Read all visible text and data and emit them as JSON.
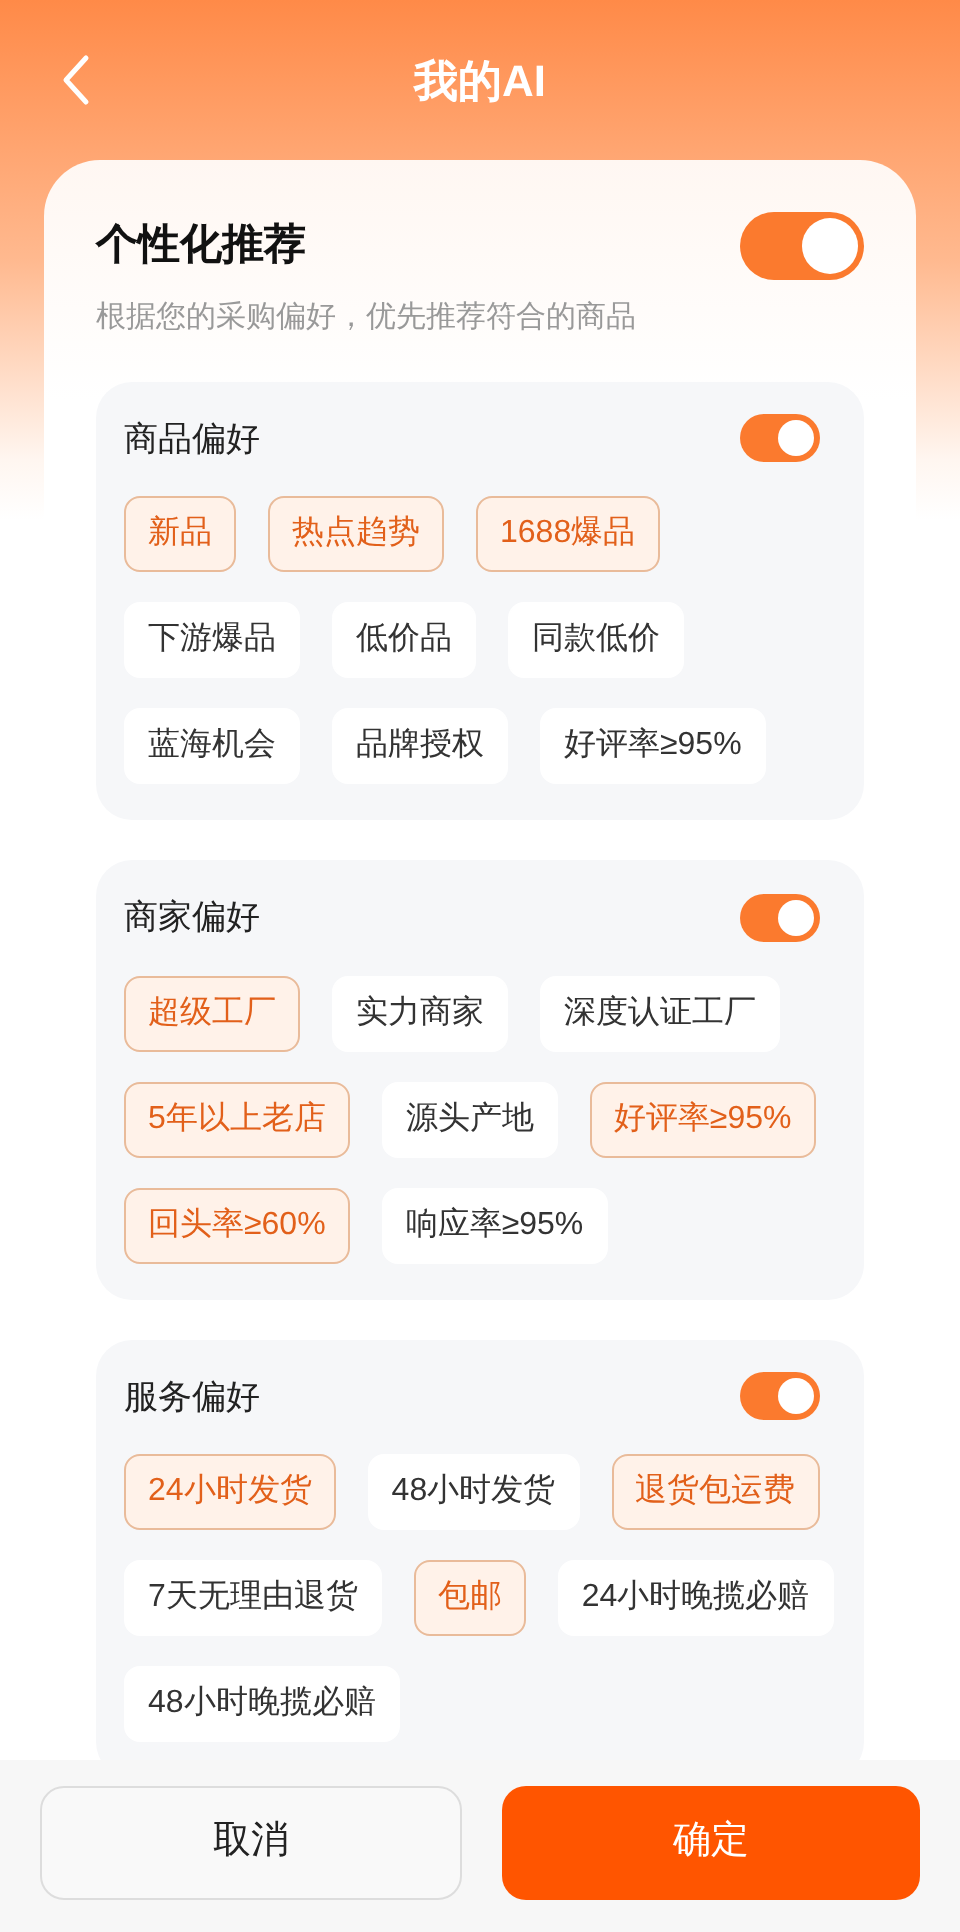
{
  "header": {
    "title": "我的AI"
  },
  "personalized": {
    "title": "个性化推荐",
    "on": true,
    "description": "根据您的采购偏好，优先推荐符合的商品"
  },
  "sections": [
    {
      "title": "商品偏好",
      "on": true,
      "tags": [
        {
          "label": "新品",
          "selected": true
        },
        {
          "label": "热点趋势",
          "selected": true
        },
        {
          "label": "1688爆品",
          "selected": true
        },
        {
          "label": "下游爆品",
          "selected": false
        },
        {
          "label": "低价品",
          "selected": false
        },
        {
          "label": "同款低价",
          "selected": false
        },
        {
          "label": "蓝海机会",
          "selected": false
        },
        {
          "label": "品牌授权",
          "selected": false
        },
        {
          "label": "好评率≥95%",
          "selected": false
        }
      ]
    },
    {
      "title": "商家偏好",
      "on": true,
      "tags": [
        {
          "label": "超级工厂",
          "selected": true
        },
        {
          "label": "实力商家",
          "selected": false
        },
        {
          "label": "深度认证工厂",
          "selected": false
        },
        {
          "label": "5年以上老店",
          "selected": true
        },
        {
          "label": "源头产地",
          "selected": false
        },
        {
          "label": "好评率≥95%",
          "selected": true
        },
        {
          "label": "回头率≥60%",
          "selected": true
        },
        {
          "label": "响应率≥95%",
          "selected": false
        }
      ]
    },
    {
      "title": "服务偏好",
      "on": true,
      "tags": [
        {
          "label": "24小时发货",
          "selected": true
        },
        {
          "label": "48小时发货",
          "selected": false
        },
        {
          "label": "退货包运费",
          "selected": true
        },
        {
          "label": "7天无理由退货",
          "selected": false
        },
        {
          "label": "包邮",
          "selected": true
        },
        {
          "label": "24小时晚揽必赔",
          "selected": false
        },
        {
          "label": "48小时晚揽必赔",
          "selected": false
        }
      ]
    }
  ],
  "buttons": {
    "cancel": "取消",
    "confirm": "确定"
  }
}
